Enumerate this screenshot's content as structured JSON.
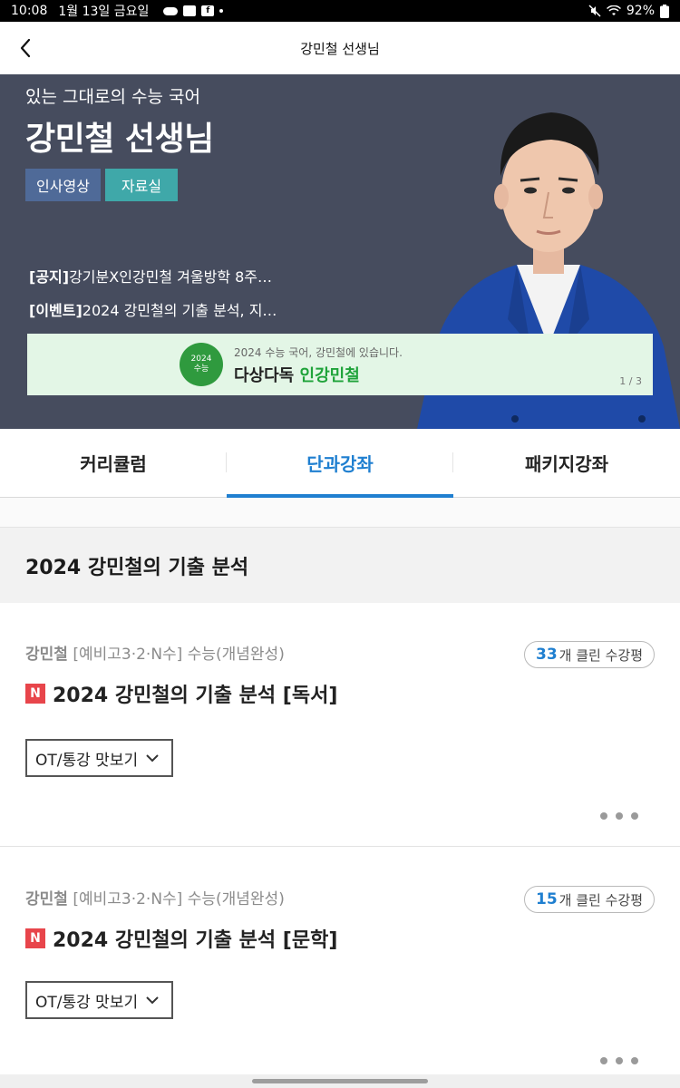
{
  "status_bar": {
    "time": "10:08",
    "date": "1월 13일 금요일",
    "notification_icons": [
      "cloud-icon",
      "twitch-icon",
      "facebook-icon",
      "dot-icon"
    ],
    "battery": "92%"
  },
  "app_bar": {
    "title": "강민철 선생님",
    "back_icon": "chevron-left-icon"
  },
  "hero": {
    "subtitle": "있는 그대로의 수능 국어",
    "title": "강민철 선생님",
    "buttons": {
      "greeting": "인사영상",
      "materials": "자료실"
    },
    "notices": [
      {
        "tag": "[공지]",
        "text": "강기분X인강민철 겨울방학 8주…"
      },
      {
        "tag": "[이벤트]",
        "text": "2024 강민철의 기출 분석, 지…"
      }
    ],
    "banner": {
      "seal_year": "2024",
      "seal_label": "수능",
      "small_text": "2024 수능 국어, 강민철에 있습니다.",
      "big_text_plain": "다상다독",
      "big_text_green": "인강민철",
      "page_indicator": "1 / 3",
      "green_color": "#1fa33a"
    }
  },
  "tabs": [
    {
      "label": "커리큘럼",
      "active": false
    },
    {
      "label": "단과강좌",
      "active": true
    },
    {
      "label": "패키지강좌",
      "active": false
    }
  ],
  "section": {
    "title": "2024 강민철의 기출 분석"
  },
  "courses": [
    {
      "teacher": "강민철",
      "target": "[예비고3·2·N수]",
      "subject": "수능(개념완성)",
      "review_count": "33",
      "review_suffix": "개 클린 수강평",
      "badge": "N",
      "title": "2024 강민철의 기출 분석 [독서]",
      "preview_label": "OT/통강 맛보기"
    },
    {
      "teacher": "강민철",
      "target": "[예비고3·2·N수]",
      "subject": "수능(개념완성)",
      "review_count": "15",
      "review_suffix": "개 클린 수강평",
      "badge": "N",
      "title": "2024 강민철의 기출 분석 [문학]",
      "preview_label": "OT/통강 맛보기"
    }
  ],
  "colors": {
    "accent_blue": "#1f7fd0",
    "hero_bg": "#464c5e",
    "greeting_btn": "#4f6a98",
    "materials_btn": "#3fa8a9",
    "new_badge": "#e8454b"
  }
}
